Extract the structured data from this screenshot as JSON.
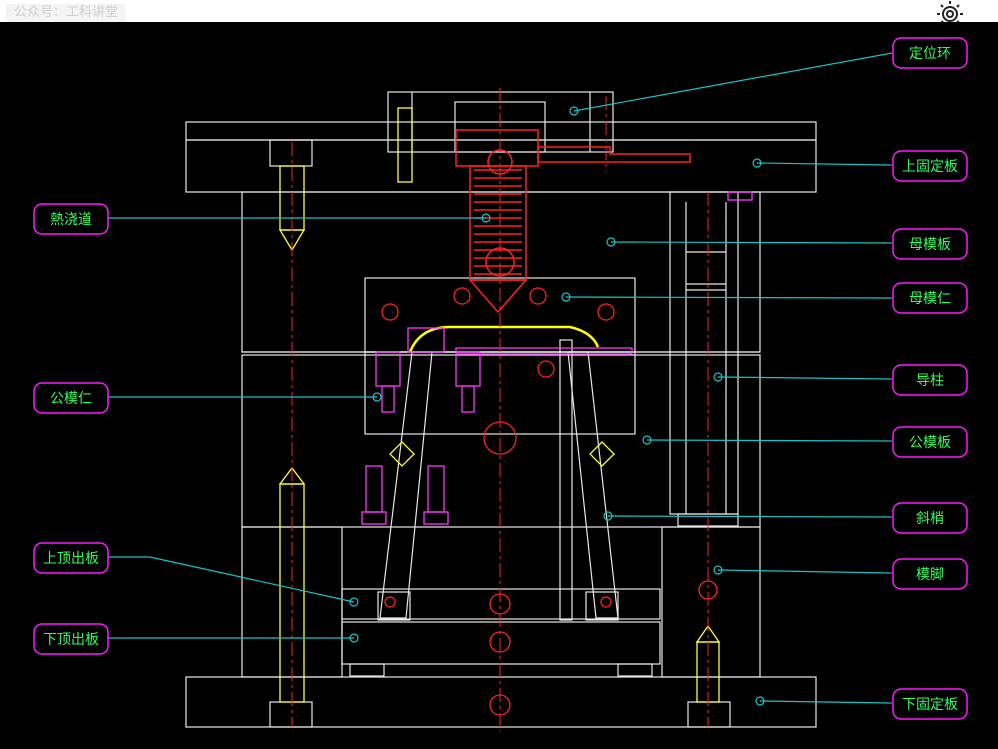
{
  "watermark": "公众号：工科讲堂",
  "icons": {
    "corner": "gear-icon"
  },
  "colors": {
    "background": "#000000",
    "outline": "#e8e8e8",
    "hot_runner": "#ff2020",
    "leader_line": "#19c4c4",
    "label_box": "#ff19ff",
    "label_text": "#2bff5a",
    "bolt": "#ffff33",
    "part": "#ff33ff",
    "centerline": "#ff2020",
    "product": "#ffff00"
  },
  "labels": {
    "locating_ring": "定位环",
    "top_clamp_plate": "上固定板",
    "hot_runner": "熱浇道",
    "cavity_plate": "母模板",
    "cavity_insert": "母模仁",
    "core_insert": "公模仁",
    "guide_pillar": "导柱",
    "core_plate": "公模板",
    "lifter": "斜梢",
    "spacer_block": "模脚",
    "ejector_retainer_plate": "上顶出板",
    "ejector_plate": "下顶出板",
    "bottom_clamp_plate": "下固定板"
  }
}
